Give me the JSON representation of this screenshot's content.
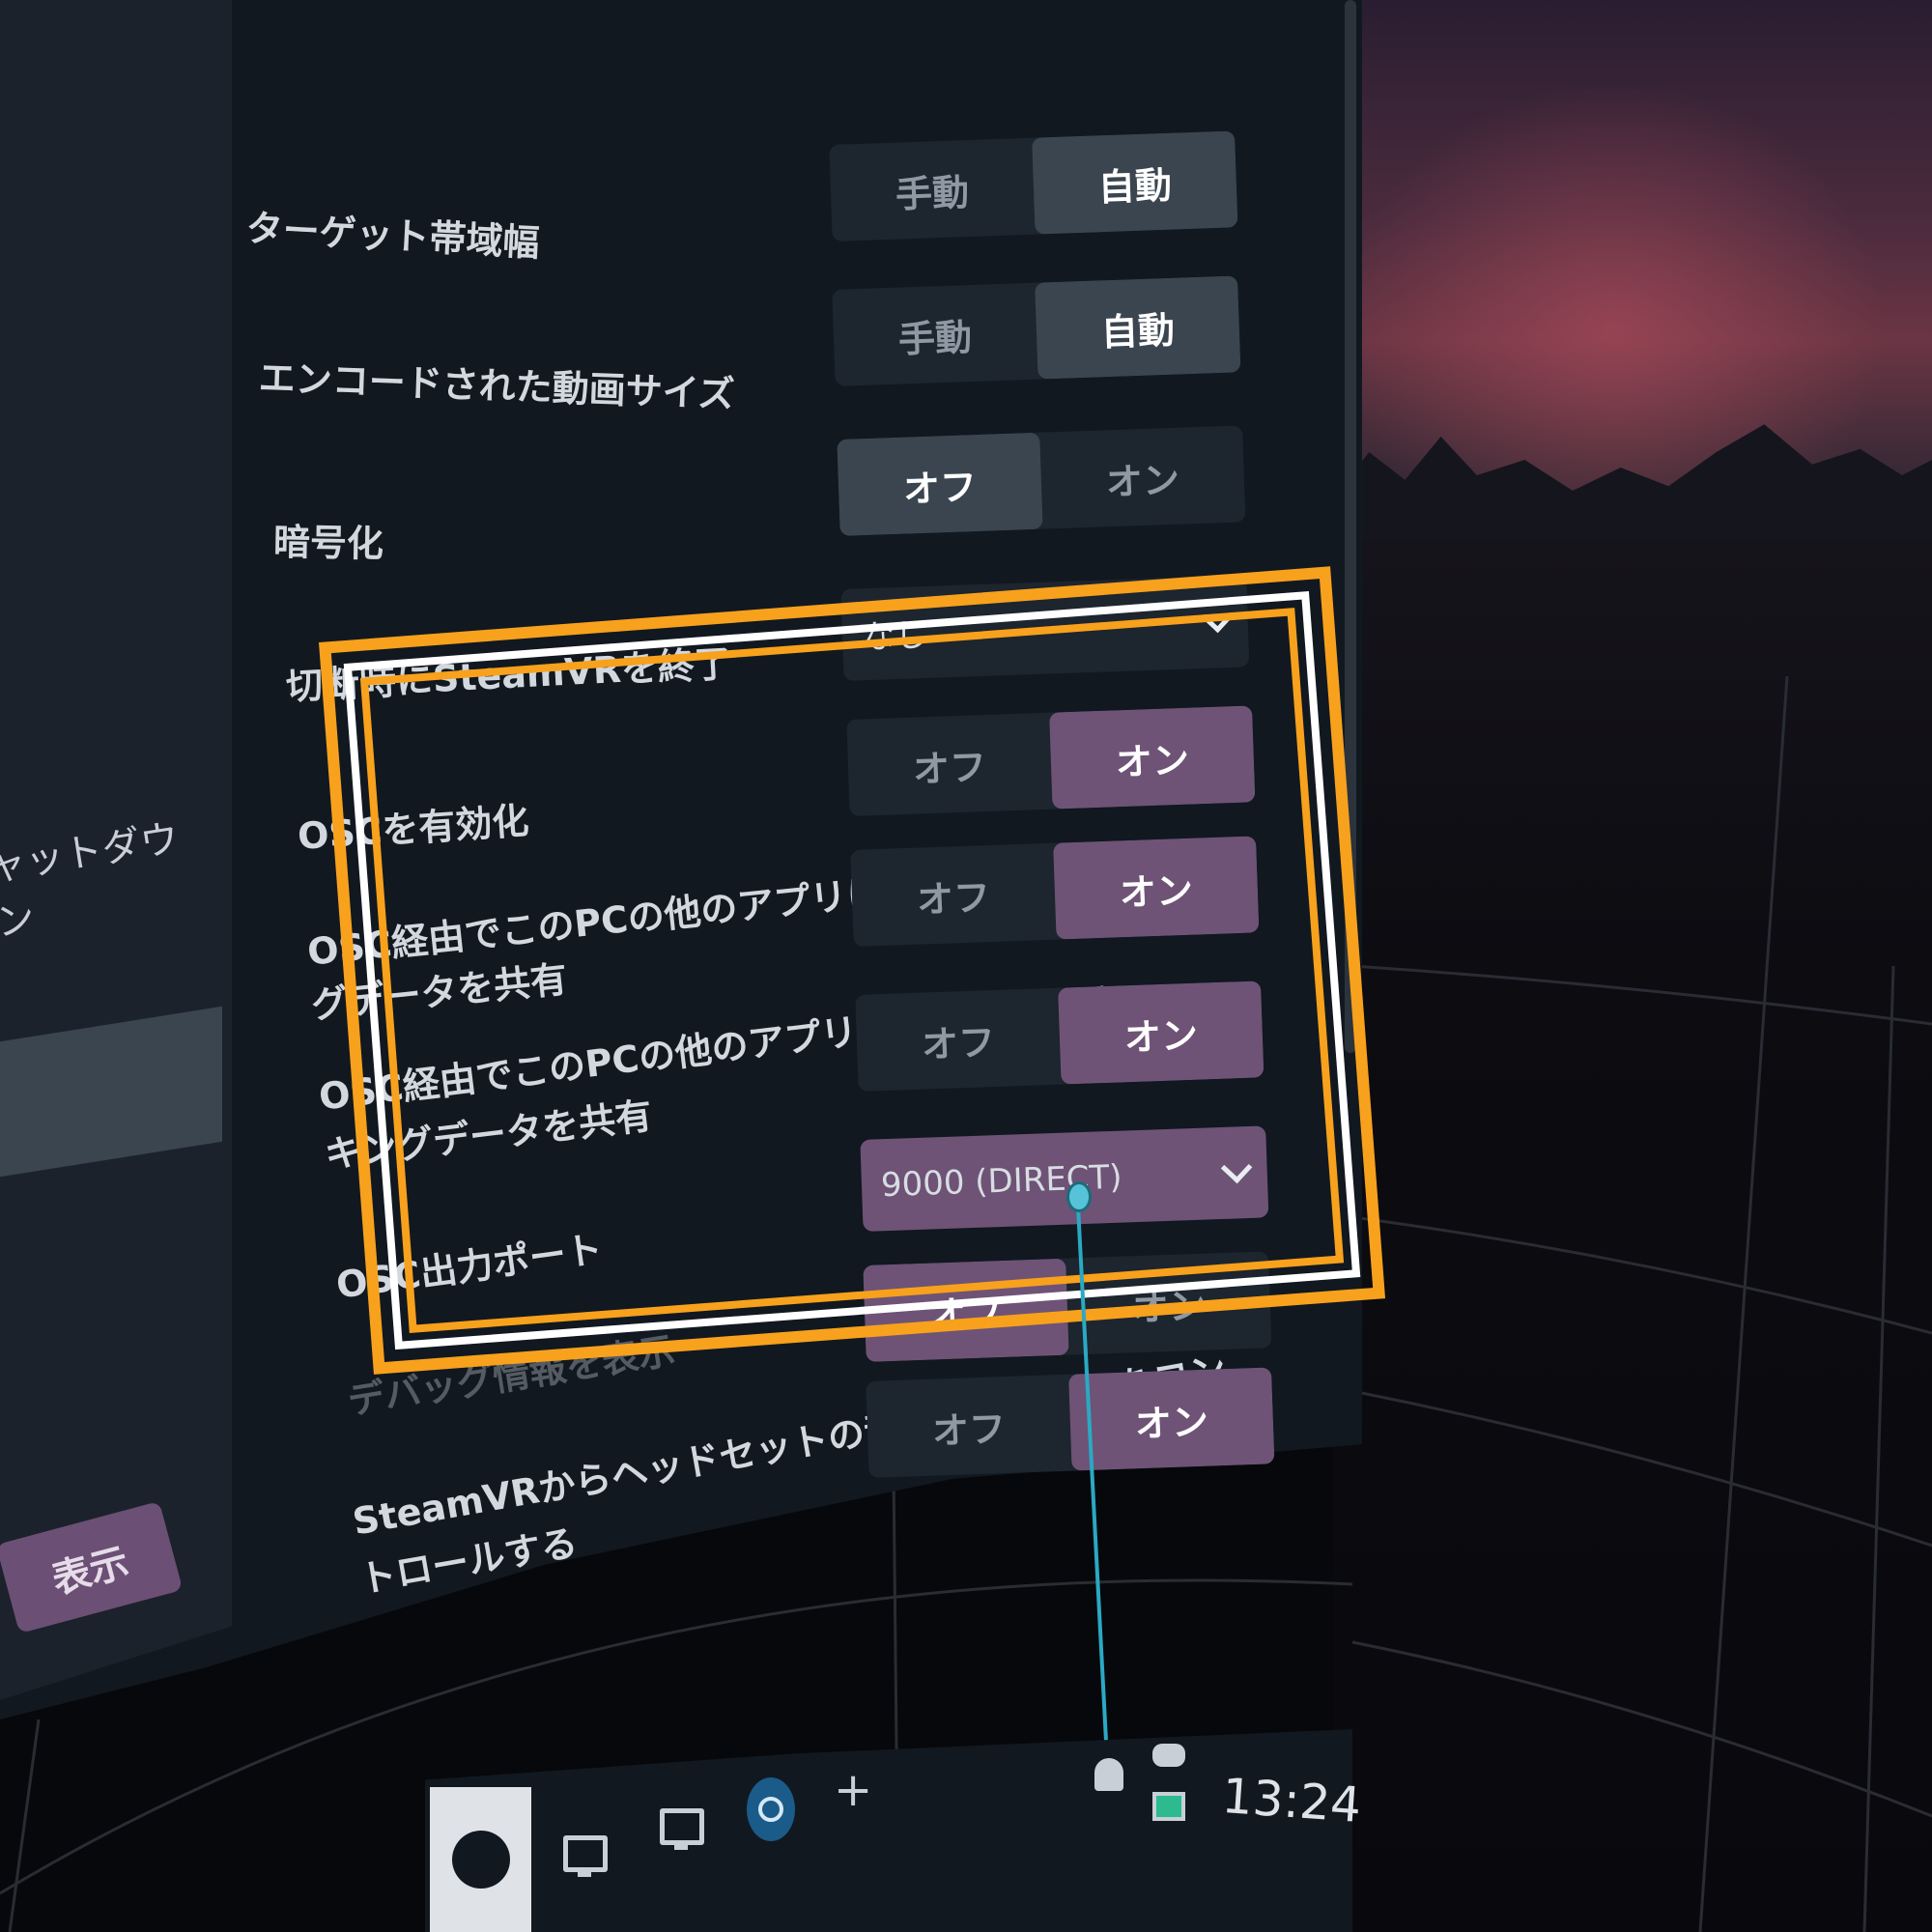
{
  "settings": {
    "target_bandwidth": {
      "label": "ターゲット帯域幅",
      "options": [
        "手動",
        "自動"
      ],
      "selected": "自動"
    },
    "encoded_video_size": {
      "label": "エンコードされた動画サイズ",
      "options": [
        "手動",
        "自動"
      ],
      "selected": "自動"
    },
    "encryption": {
      "label": "暗号化",
      "options": [
        "オフ",
        "オン"
      ],
      "selected": "オフ"
    },
    "quit_steamvr_on_disconnect": {
      "label": "切断時にSteamVRを終了",
      "value": "なし"
    },
    "enable_osc": {
      "label": "OSCを有効化",
      "options": [
        "オフ",
        "オン"
      ],
      "selected": "オン"
    },
    "share_eye_tracking": {
      "label_line1": "OSC経由でこのPCの他のアプリにアイトラッキン",
      "label_line2": "グデータを共有",
      "options": [
        "オフ",
        "オン"
      ],
      "selected": "オン"
    },
    "share_face_tracking": {
      "label_line1": "OSC経由でこのPCの他のアプリにフェイストラッ",
      "label_line2": "キングデータを共有",
      "options": [
        "オフ",
        "オン"
      ],
      "selected": "オン"
    },
    "osc_output_port": {
      "label": "OSC出力ポート",
      "value": "9000 (DIRECT)"
    },
    "show_debug": {
      "label": "デバッグ情報を表示",
      "options": [
        "オフ",
        "オン"
      ],
      "selected": "オフ"
    },
    "control_headset_volume": {
      "label_line1": "SteamVRからヘッドセットの音量とミュートをコン",
      "label_line2": "トロールする",
      "options": [
        "オフ",
        "オン"
      ],
      "selected": "オン"
    }
  },
  "sidebar": {
    "shutdown_label": "ャットダウン",
    "show_button": "表示"
  },
  "taskbar": {
    "add_label": "+",
    "clock": "13:24"
  },
  "colors": {
    "highlight": "#f7a11d",
    "purple_active": "#6e5376",
    "panel": "#111820",
    "laser": "#2aa9c4"
  }
}
